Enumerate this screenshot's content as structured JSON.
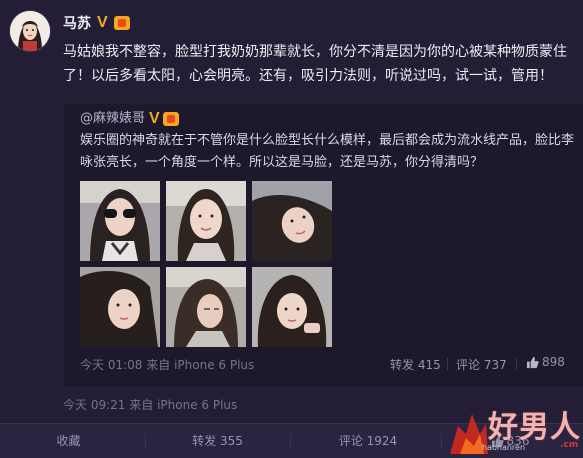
{
  "post": {
    "author": "马苏",
    "verified_badge": "V",
    "text": "马姑娘我不整容，脸型打我奶奶那辈就长，你分不清是因为你的心被某种物质蒙住了！以后多看太阳，心会明亮。还有，吸引力法则，听说过吗，试一试，管用！",
    "time": "今天 09:21",
    "source_prefix": "来自",
    "source_device": "iPhone 6 Plus"
  },
  "repost": {
    "author": "@麻辣婊哥",
    "verified_badge": "V",
    "text": "娱乐圈的神奇就在于不管你是什么脸型长什么模样，最后都会成为流水线产品，脸比李咏张亮长，一个角度一个样。所以这是马脸，还是马苏，你分得清吗？",
    "time": "今天 01:08",
    "source_prefix": "来自",
    "source_device": "iPhone 6 Plus",
    "repost_label": "转发 415",
    "comment_label": "评论 737",
    "like_count": "898"
  },
  "footer": {
    "favorite": "收藏",
    "repost": "转发 355",
    "comment": "评论 1924",
    "like_count": "836"
  },
  "watermark": {
    "main": "好男人",
    "sub": "haonanren",
    "domain": ".cm"
  },
  "colors": {
    "background": "#231d35",
    "repost_background": "#1d182c",
    "badge": "#f5a623",
    "muted_text": "#77738d"
  },
  "thumbnails": [
    {
      "name": "photo-sunglasses"
    },
    {
      "name": "photo-selfie-smile"
    },
    {
      "name": "photo-lying-down"
    },
    {
      "name": "photo-close-up"
    },
    {
      "name": "photo-side-hair"
    },
    {
      "name": "photo-leaning"
    }
  ]
}
